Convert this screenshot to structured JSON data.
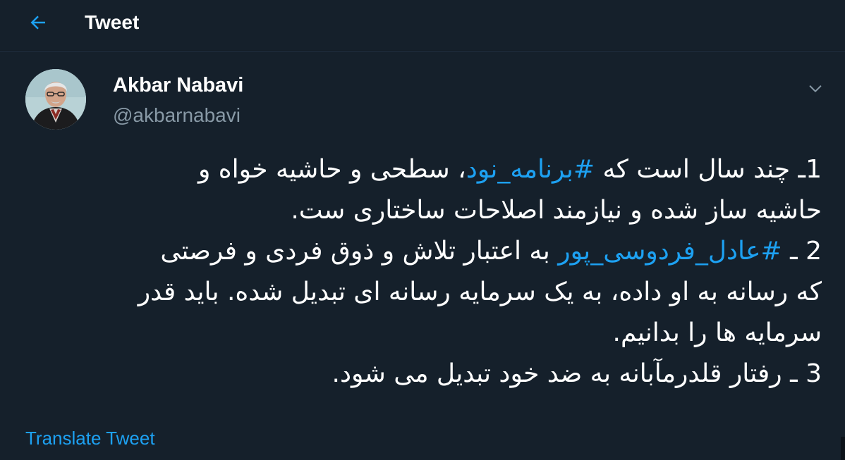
{
  "header": {
    "title": "Tweet",
    "back_icon": "arrow-left-icon"
  },
  "author": {
    "display_name": "Akbar Nabavi",
    "handle": "@akbarnabavi",
    "avatar_icon": "profile-photo"
  },
  "menu": {
    "caret_icon": "chevron-down-icon"
  },
  "tweet": {
    "lines": [
      {
        "pre": "1ـ چند سال است که ",
        "tag": "#برنامه_نود",
        "post": "، سطحی و حاشیه خواه و"
      },
      {
        "pre": "حاشیه ساز شده و نیازمند اصلاحات ساختاری ست.",
        "tag": "",
        "post": ""
      },
      {
        "pre": "2 ـ ",
        "tag": "#عادل_فردوسی_پور",
        "post": " به اعتبار تلاش و ذوق فردی و فرصتی"
      },
      {
        "pre": "که رسانه به او داده، به یک سرمایه رسانه ای تبدیل شده. باید قدر",
        "tag": "",
        "post": ""
      },
      {
        "pre": "سرمایه ها را بدانیم.",
        "tag": "",
        "post": ""
      },
      {
        "pre": "3 ـ رفتار قلدرمآبانه به ضد خود تبدیل می شود.",
        "tag": "",
        "post": ""
      }
    ]
  },
  "footer": {
    "translate_label": "Translate Tweet"
  },
  "colors": {
    "background": "#15202b",
    "accent": "#1da1f2",
    "secondary_text": "#8899a6",
    "primary_text": "#ffffff"
  }
}
